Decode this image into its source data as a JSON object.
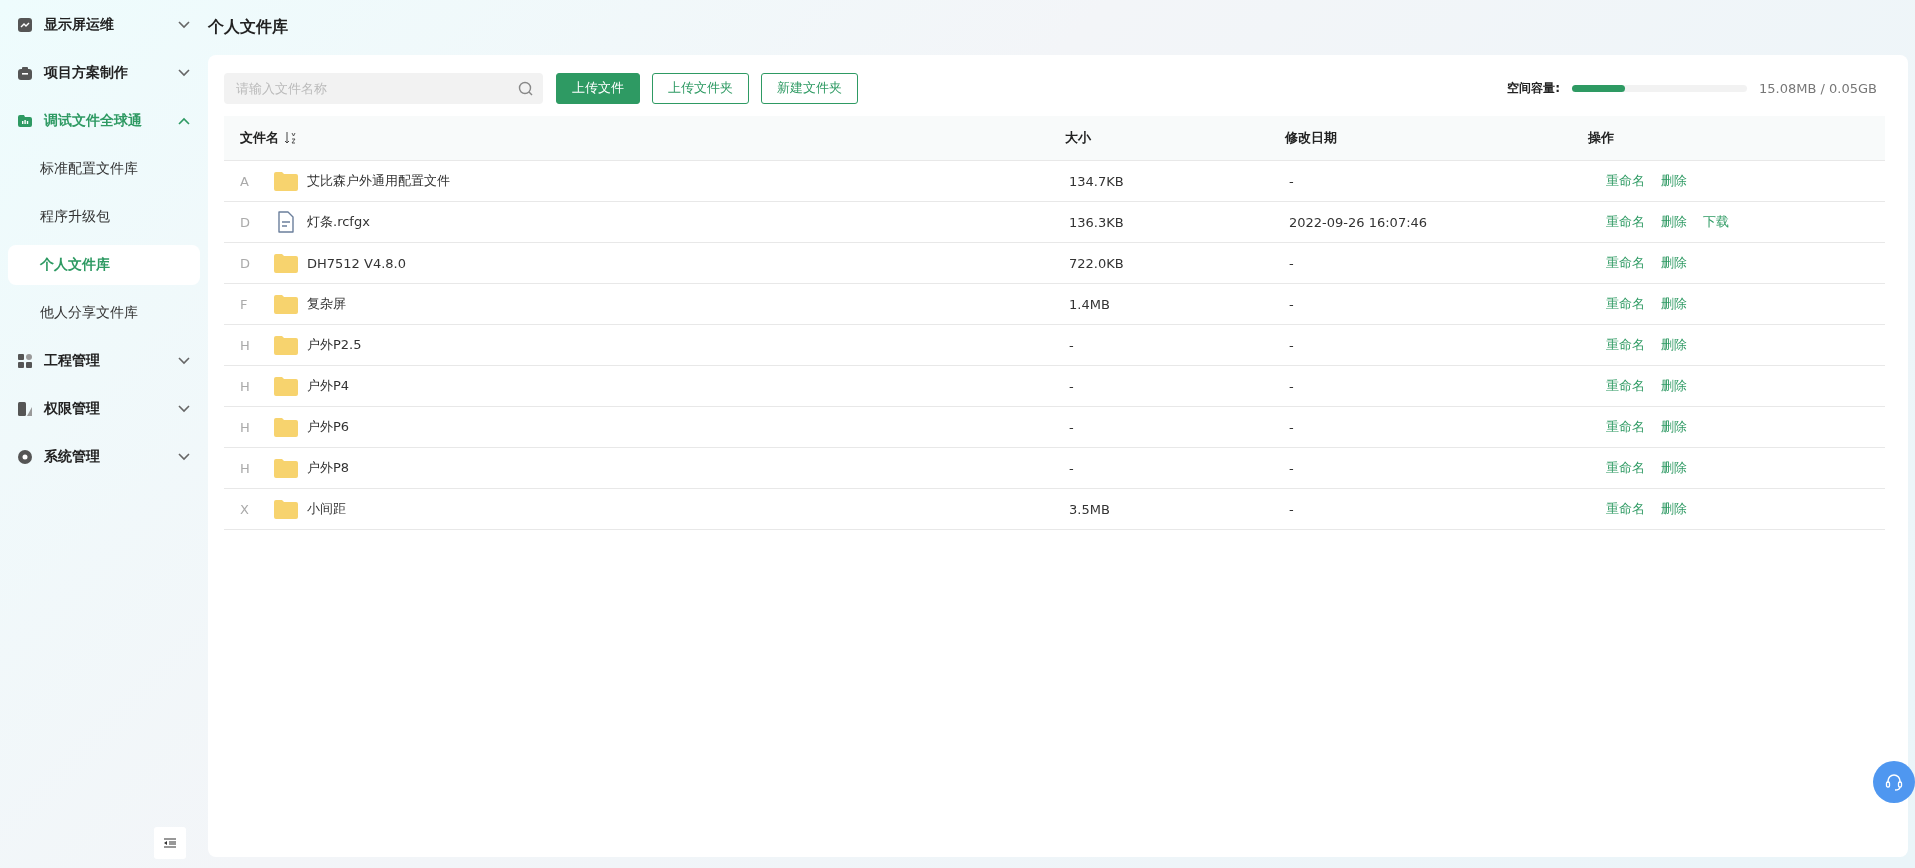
{
  "sidebar": {
    "items": [
      {
        "label": "显示屏运维",
        "expanded": false
      },
      {
        "label": "项目方案制作",
        "expanded": false
      },
      {
        "label": "调试文件全球通",
        "expanded": true,
        "children": [
          {
            "label": "标准配置文件库",
            "selected": false
          },
          {
            "label": "程序升级包",
            "selected": false
          },
          {
            "label": "个人文件库",
            "selected": true
          },
          {
            "label": "他人分享文件库",
            "selected": false
          }
        ]
      },
      {
        "label": "工程管理",
        "expanded": false
      },
      {
        "label": "权限管理",
        "expanded": false
      },
      {
        "label": "系统管理",
        "expanded": false
      }
    ]
  },
  "page_title": "个人文件库",
  "toolbar": {
    "search": {
      "placeholder": "请输入文件名称"
    },
    "buttons": [
      {
        "label": "上传文件",
        "kind": "primary"
      },
      {
        "label": "上传文件夹",
        "kind": "outline"
      },
      {
        "label": "新建文件夹",
        "kind": "outline"
      }
    ],
    "storage": {
      "label": "空间容量:",
      "level": 0.3,
      "reading": "15.08MB / 0.05GB"
    }
  },
  "table": {
    "columns": [
      "文件名",
      "大小",
      "修改日期",
      "操作"
    ],
    "rows": [
      {
        "group": "A",
        "kind": "folder",
        "name": "艾比森户外通用配置文件",
        "size": "134.7KB",
        "date": "-",
        "actions": [
          "重命名",
          "删除"
        ]
      },
      {
        "group": "D",
        "kind": "file",
        "name": "灯条.rcfgx",
        "size": "136.3KB",
        "date": "2022-09-26 16:07:46",
        "actions": [
          "重命名",
          "删除",
          "下载"
        ]
      },
      {
        "group": "D",
        "kind": "folder",
        "name": "DH7512 V4.8.0",
        "size": "722.0KB",
        "date": "-",
        "actions": [
          "重命名",
          "删除"
        ]
      },
      {
        "group": "F",
        "kind": "folder",
        "name": "复杂屏",
        "size": "1.4MB",
        "date": "-",
        "actions": [
          "重命名",
          "删除"
        ]
      },
      {
        "group": "H",
        "kind": "folder",
        "name": "户外P2.5",
        "size": "-",
        "date": "-",
        "actions": [
          "重命名",
          "删除"
        ]
      },
      {
        "group": "H",
        "kind": "folder",
        "name": "户外P4",
        "size": "-",
        "date": "-",
        "actions": [
          "重命名",
          "删除"
        ]
      },
      {
        "group": "H",
        "kind": "folder",
        "name": "户外P6",
        "size": "-",
        "date": "-",
        "actions": [
          "重命名",
          "删除"
        ]
      },
      {
        "group": "H",
        "kind": "folder",
        "name": "户外P8",
        "size": "-",
        "date": "-",
        "actions": [
          "重命名",
          "删除"
        ]
      },
      {
        "group": "X",
        "kind": "folder",
        "name": "小间距",
        "size": "3.5MB",
        "date": "-",
        "actions": [
          "重命名",
          "删除"
        ]
      }
    ]
  }
}
